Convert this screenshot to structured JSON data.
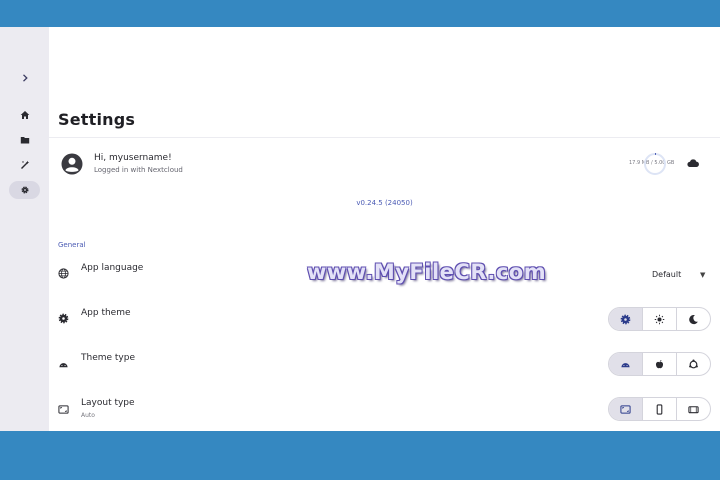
{
  "sidebar": {
    "items": [
      {
        "id": "expand",
        "icon": "chevron-right-icon"
      },
      {
        "id": "home",
        "icon": "home-icon"
      },
      {
        "id": "files",
        "icon": "folder-icon"
      },
      {
        "id": "tools",
        "icon": "magic-wand-icon"
      },
      {
        "id": "settings",
        "icon": "gear-icon",
        "active": true
      }
    ]
  },
  "header": {
    "title": "Settings"
  },
  "account": {
    "greeting": "Hi, myusername!",
    "subtitle": "Logged in with Nextcloud",
    "quota": "17.9 MB / 5.00 GB",
    "quota_fraction": 0.004
  },
  "version": "v0.24.5 (24050)",
  "general": {
    "section_title": "General",
    "app_language": {
      "label": "App language",
      "value": "Default"
    },
    "app_theme": {
      "label": "App theme",
      "options": [
        "auto",
        "light",
        "dark"
      ],
      "selected": "auto"
    },
    "theme_type": {
      "label": "Theme type",
      "options": [
        "android",
        "apple",
        "other"
      ],
      "selected": "android"
    },
    "layout_type": {
      "label": "Layout type",
      "subtitle": "Auto",
      "options": [
        "auto",
        "phone",
        "tablet"
      ],
      "selected": "auto"
    }
  },
  "watermark": "www.MyFileCR.com",
  "colors": {
    "accent": "#4b5bb4",
    "frame": "#3588c1",
    "sidebar": "#ecebf1",
    "selected": "#e1e0e9"
  }
}
